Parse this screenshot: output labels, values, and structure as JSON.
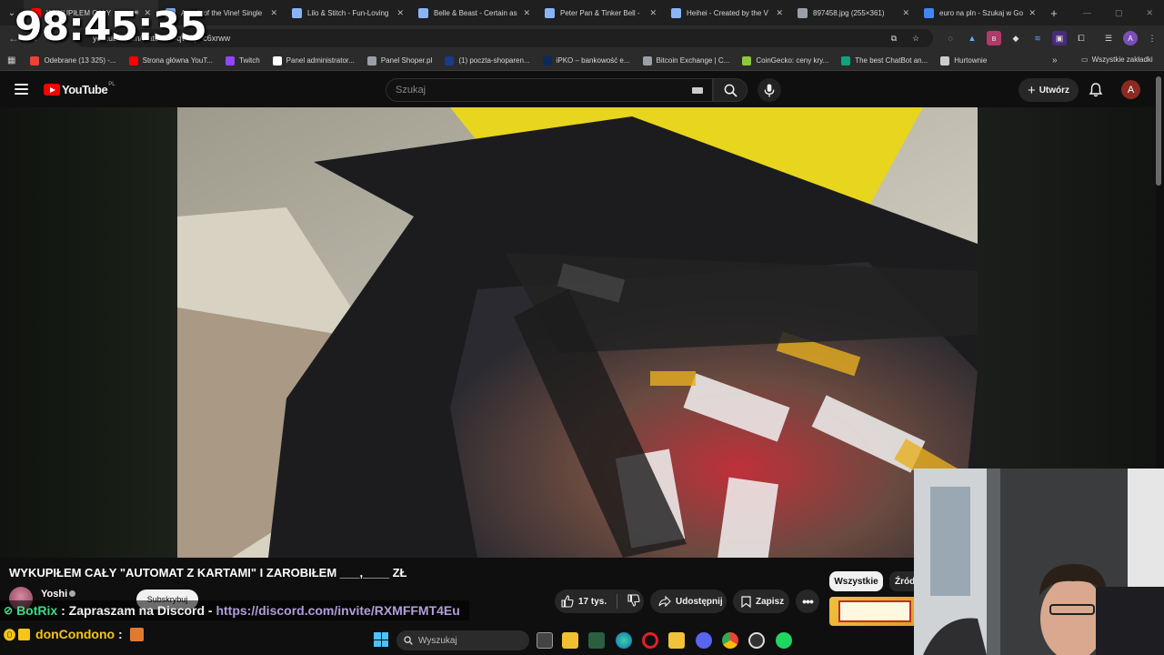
{
  "stream_timer": "98:45:35",
  "browser": {
    "tabs": [
      {
        "title": "WYKUPIŁEM CAŁY",
        "favicon": "youtube-icon",
        "color": "#ff0000",
        "active": true
      },
      {
        "title": "Attack of the Vine! Single",
        "favicon": "doc-icon",
        "color": "#8ab4f8"
      },
      {
        "title": "Lilo & Stitch - Fun-Loving",
        "favicon": "doc-icon",
        "color": "#8ab4f8"
      },
      {
        "title": "Belle & Beast - Certain as",
        "favicon": "doc-icon",
        "color": "#8ab4f8"
      },
      {
        "title": "Peter Pan & Tinker Bell -",
        "favicon": "doc-icon",
        "color": "#8ab4f8"
      },
      {
        "title": "Heihei - Created by the V",
        "favicon": "doc-icon",
        "color": "#8ab4f8"
      },
      {
        "title": "897458.jpg (255×361)",
        "favicon": "globe-icon",
        "color": "#9aa0a6"
      },
      {
        "title": "euro na pln - Szukaj w Go",
        "favicon": "google-icon",
        "color": "#4285f4"
      }
    ],
    "url": "youtube.com/watch?v=qWAyFc6xrww",
    "bookmarks": [
      {
        "label": "Odebrane (13 325) -...",
        "icon": "gmail-icon",
        "color": "#ea4335"
      },
      {
        "label": "Strona główna YouT...",
        "icon": "youtube-icon",
        "color": "#ff0000"
      },
      {
        "label": "Twitch",
        "icon": "twitch-icon",
        "color": "#9146ff"
      },
      {
        "label": "Panel administrator...",
        "icon": "shopper-icon",
        "color": "#ffffff"
      },
      {
        "label": "Panel Shoper.pl",
        "icon": "globe-icon",
        "color": "#9aa0a6"
      },
      {
        "label": "(1) poczta-shoparen...",
        "icon": "mail-icon",
        "color": "#1a3a8a"
      },
      {
        "label": "iPKO – bankowość e...",
        "icon": "bank-icon",
        "color": "#0a2a5c"
      },
      {
        "label": "Bitcoin Exchange | C...",
        "icon": "globe-icon",
        "color": "#9aa0a6"
      },
      {
        "label": "CoinGecko: ceny kry...",
        "icon": "coingecko-icon",
        "color": "#8dc63f"
      },
      {
        "label": "The best ChatBot an...",
        "icon": "chatbot-icon",
        "color": "#10a37f"
      },
      {
        "label": "Hurtownie",
        "icon": "folder-icon",
        "color": "#cccccc"
      }
    ],
    "all_bookmarks": "Wszystkie zakładki"
  },
  "youtube": {
    "logo_text": "YouTube",
    "country_code": "PL",
    "search_placeholder": "Szukaj",
    "create_label": "Utwórz",
    "avatar_letter": "A",
    "video_title": "WYKUPIŁEM CAŁY \"AUTOMAT Z KARTAMI\" I ZAROBIŁEM ___,____ ZŁ",
    "channel_name": "Yoshi",
    "subscribe_label": "Subskrybuj",
    "likes": "17 tys.",
    "share_label": "Udostępnij",
    "save_label": "Zapisz",
    "filter_chips": [
      "Wszystkie",
      "Źródło"
    ]
  },
  "chat": [
    {
      "user": "BotRix",
      "separator": " : ",
      "message": "Zapraszam na Discord - ",
      "link": "https://discord.com/invite/RXMFFMT4Eu",
      "user_color": "#3ddc84"
    },
    {
      "user": "donCondono",
      "separator": " : ",
      "message": "",
      "link": "",
      "user_color": "#f5c518"
    }
  ],
  "taskbar": {
    "search_placeholder": "Wyszukaj"
  }
}
